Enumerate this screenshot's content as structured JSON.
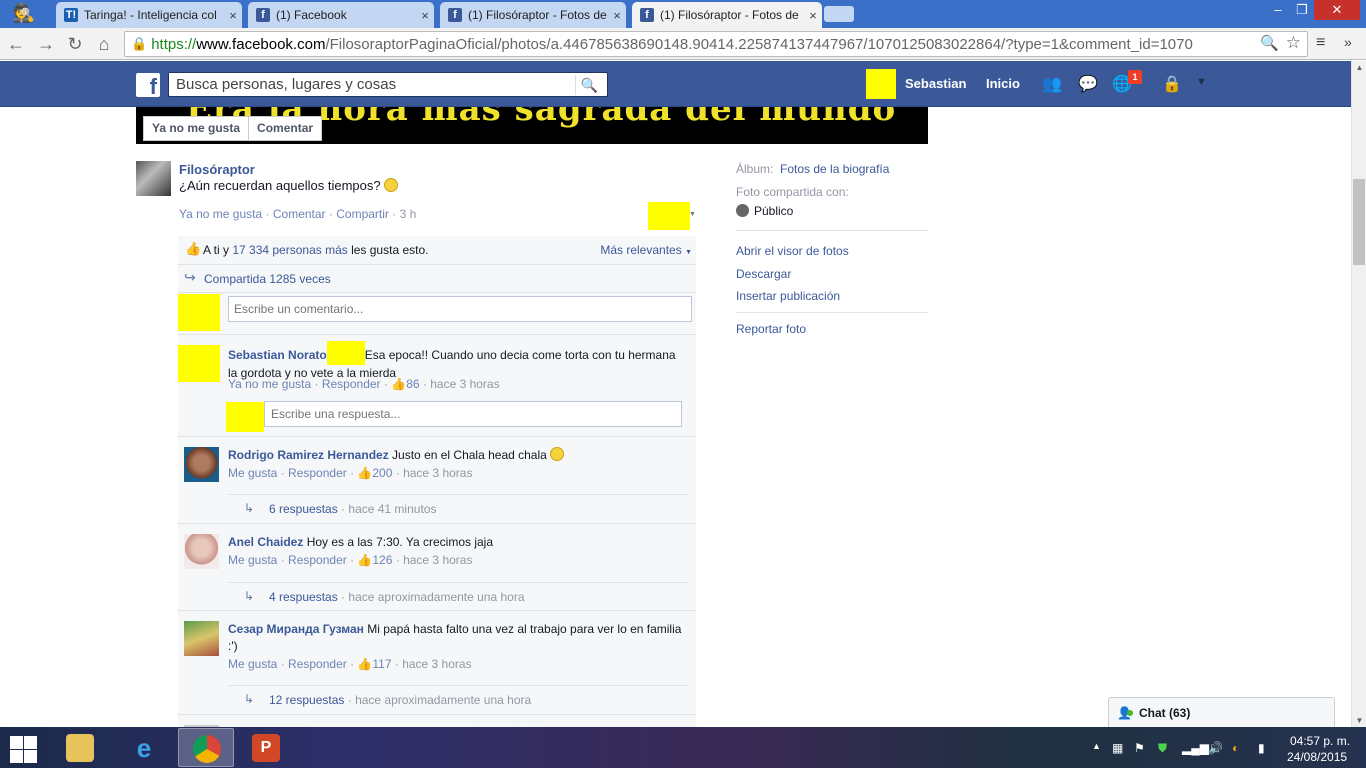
{
  "browser": {
    "tabs": [
      {
        "title": "Taringa! - Inteligencia col",
        "favicon": "T!"
      },
      {
        "title": "(1) Facebook",
        "favicon": "f"
      },
      {
        "title": "(1) Filosóraptor - Fotos de",
        "favicon": "f"
      },
      {
        "title": "(1) Filosóraptor - Fotos de",
        "favicon": "f"
      }
    ],
    "url_scheme": "https://",
    "url_host": "www.facebook.com",
    "url_path": "/FilosoraptorPaginaOficial/photos/a.446785638690148.90414.225874137447967/1070125083022864/?type=1&comment_id=1070"
  },
  "fb": {
    "logo": "f",
    "search_placeholder": "Busca personas, lugares y cosas",
    "profile_name": "Sebastian",
    "home": "Inicio",
    "notif_count": "1"
  },
  "photo": {
    "caption": "Era la hora más sagrada del mundo",
    "unlike": "Ya no me gusta",
    "comment": "Comentar"
  },
  "post": {
    "page_name": "Filosóraptor",
    "text": "¿Aún recuerdan aquellos tiempos?",
    "unlike": "Ya no me gusta",
    "comment": "Comentar",
    "share": "Compartir",
    "time": "3 h"
  },
  "ufi": {
    "likes_prefix": "A ti y ",
    "likes_people": "17 334 personas más",
    "likes_suffix": " les gusta esto.",
    "most_relevant": "Más relevantes",
    "shares": "Compartida 1285 veces",
    "compose_placeholder": "Escribe un comentario...",
    "reply_placeholder": "Escribe una respuesta...",
    "comments": [
      {
        "name": "Sebastian Norato",
        "text": "Esa epoca!! Cuando uno decia come torta con tu hermana la gordota y no vete a la mierda",
        "like": "Ya no me gusta",
        "reply": "Responder",
        "likes": "86",
        "time": "hace 3 horas"
      },
      {
        "name": "Rodrigo Ramirez Hernandez",
        "text": "Justo en el Chala head chala",
        "like": "Me gusta",
        "reply": "Responder",
        "likes": "200",
        "time": "hace 3 horas",
        "replies": "6 respuestas",
        "replies_time": "hace 41 minutos"
      },
      {
        "name": "Anel Chaidez",
        "text": "Hoy es a las 7:30. Ya crecimos jaja",
        "like": "Me gusta",
        "reply": "Responder",
        "likes": "126",
        "time": "hace 3 horas",
        "replies": "4 respuestas",
        "replies_time": "hace aproximadamente una hora"
      },
      {
        "name": "Сезар Миранда Гузман",
        "text": "Mi papá hasta falto una vez al trabajo para ver lo en familia :')",
        "like": "Me gusta",
        "reply": "Responder",
        "likes": "117",
        "time": "hace 3 horas",
        "replies": "12 respuestas",
        "replies_time": "hace aproximadamente una hora"
      }
    ]
  },
  "sidebar": {
    "album_label": "Álbum:",
    "album_value": "Fotos de la biografía",
    "shared_label": "Foto compartida con:",
    "privacy": "Público",
    "links": [
      "Abrir el visor de fotos",
      "Descargar",
      "Insertar publicación",
      "Reportar foto"
    ]
  },
  "chat": {
    "label": "Chat (63)"
  },
  "taskbar": {
    "time": "04:57 p. m.",
    "date": "24/08/2015"
  },
  "colors": {
    "fb_blue": "#3b5998",
    "redacted": "#ffff00",
    "link": "#3b5998"
  }
}
